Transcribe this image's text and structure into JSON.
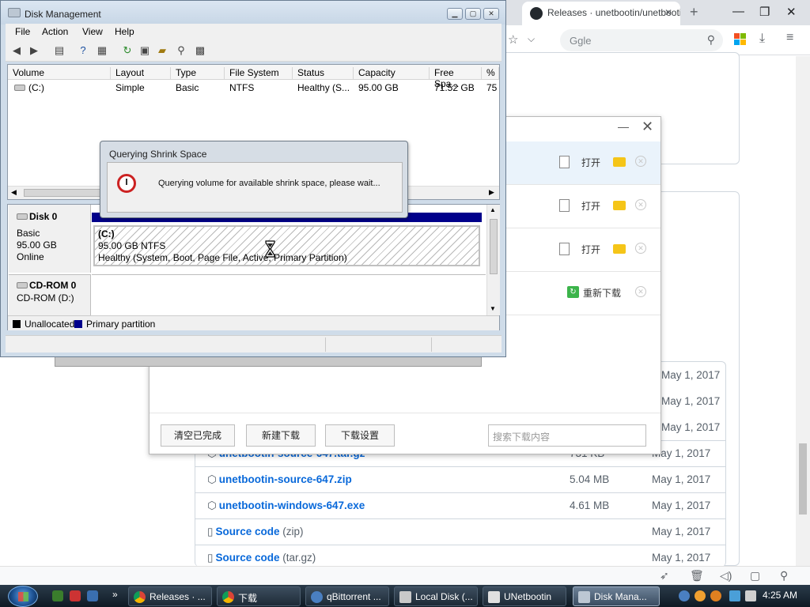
{
  "browser": {
    "tab_title": "Releases · unetbootin/unetbootin",
    "search_placeholder": "Ggle",
    "assets": [
      {
        "name": "unetbootin-source-647.tar.gz",
        "sub": "",
        "size": "731 KB",
        "date": "May 1, 2017"
      },
      {
        "name": "unetbootin-source-647.zip",
        "sub": "",
        "size": "5.04 MB",
        "date": "May 1, 2017"
      },
      {
        "name": "unetbootin-windows-647.exe",
        "sub": "",
        "size": "4.61 MB",
        "date": "May 1, 2017"
      },
      {
        "name": "Source code",
        "sub": "(zip)",
        "size": "",
        "date": "May 1, 2017"
      },
      {
        "name": "Source code",
        "sub": "(tar.gz)",
        "size": "",
        "date": "May 1, 2017"
      }
    ],
    "hidden_dates": [
      "May 1, 2017",
      "May 1, 2017",
      "May 1, 2017"
    ]
  },
  "download_dialog": {
    "open_label": "打开",
    "redownload_label": "重新下载",
    "clear_completed": "清空已完成",
    "new_download": "新建下载",
    "download_settings": "下载设置",
    "search_placeholder": "搜索下载内容"
  },
  "disk_mgmt": {
    "title": "Disk Management",
    "menu": [
      "File",
      "Action",
      "View",
      "Help"
    ],
    "columns": [
      "Volume",
      "Layout",
      "Type",
      "File System",
      "Status",
      "Capacity",
      "Free Spa...",
      "% F"
    ],
    "row": [
      "(C:)",
      "Simple",
      "Basic",
      "NTFS",
      "Healthy (S...",
      "95.00 GB",
      "71.52 GB",
      "75"
    ],
    "disk0": {
      "name": "Disk 0",
      "type": "Basic",
      "size": "95.00 GB",
      "state": "Online"
    },
    "partition": {
      "label": "(C:)",
      "size_fs": "95.00 GB NTFS",
      "status": "Healthy (System, Boot, Page File, Active, Primary Partition)"
    },
    "cdrom": {
      "name": "CD-ROM 0",
      "drive": "CD-ROM (D:)"
    },
    "legend": {
      "unallocated": "Unallocated",
      "primary": "Primary partition"
    }
  },
  "query_dialog": {
    "title": "Querying Shrink Space",
    "message": "Querying volume for available shrink space, please wait..."
  },
  "taskbar": {
    "buttons": [
      "Releases · ...",
      "下载",
      "qBittorrent ...",
      "Local Disk (...",
      "UNetbootin",
      "Disk Mana..."
    ],
    "clock": "4:25 AM"
  },
  "colors": {
    "primary_partition": "#00008b",
    "link": "#0969da"
  }
}
